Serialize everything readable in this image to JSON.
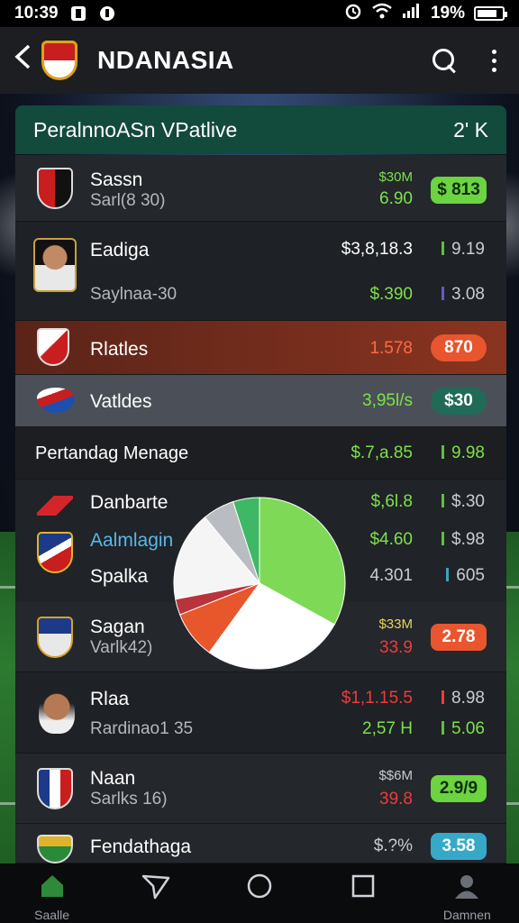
{
  "status_bar": {
    "time": "10:39",
    "battery": "19%"
  },
  "app_bar": {
    "title": "NDANASIA"
  },
  "header": {
    "title": "PeralnnoASn VPatlive",
    "value": "2' K"
  },
  "rows": [
    {
      "name": "Sassn",
      "sub": "Sarl(8 30)",
      "v1": "$30M",
      "v2": "6.90",
      "pill": "$ 813"
    },
    {
      "name": "Eadiga",
      "sub": "Saylnaa-30",
      "v1": "$3,8,18.3",
      "v2": "$.390",
      "r1": "9.19",
      "r2": "3.08"
    },
    {
      "name": "Rlatles",
      "v1": "1.578",
      "pill": "870"
    },
    {
      "name": "Vatldes",
      "v1": "3,95l/s",
      "pill": "$30"
    }
  ],
  "section": {
    "title": "Pertandag Menage",
    "v1": "$.7,a.85",
    "v2": "9.98"
  },
  "section_rows": [
    {
      "name": "Danbarte",
      "v1": "$,6l.8",
      "v2": "$.30"
    },
    {
      "name": "Aalmlagin",
      "v1": "$4.60",
      "v2": "$.98"
    },
    {
      "name": "Spalka",
      "v1": "4.301",
      "v2": "605"
    }
  ],
  "rows2": [
    {
      "name": "Sagan",
      "sub": "Varlk42)",
      "v1": "$33M",
      "v2": "33.9",
      "pill": "2.78"
    },
    {
      "name": "Rlaa",
      "sub": "Rardinao1 35",
      "v1": "$1,1.15.5",
      "v2": "2,57 H",
      "r1": "8.98",
      "r2": "5.06"
    },
    {
      "name": "Naan",
      "sub": "Sarlks 16)",
      "v1": "$$6M",
      "v2": "39.8",
      "pill": "2.9/9"
    },
    {
      "name": "Fendathaga",
      "v1": "$.?%",
      "pill": "3.58"
    }
  ],
  "nav": {
    "home": "Saalle",
    "profile": "Damnen"
  },
  "colors": {
    "accent_green": "#7ee04a",
    "accent_red": "#ef3b3b",
    "header_bg": "#124a3c",
    "orange_row": "#7a2e1e"
  },
  "icons": [
    "back-arrow-icon",
    "search-icon",
    "more-vert-icon",
    "home-icon",
    "send-icon",
    "circle-icon",
    "square-icon",
    "profile-icon"
  ],
  "chart_data": {
    "type": "pie",
    "slices": [
      {
        "color": "#7ed957",
        "value": 33
      },
      {
        "color": "#ffffff",
        "value": 27
      },
      {
        "color": "#e8562c",
        "value": 9
      },
      {
        "color": "#b8343a",
        "value": 3
      },
      {
        "color": "#f5f5f5",
        "value": 17
      },
      {
        "color": "#b9bcc0",
        "value": 6
      },
      {
        "color": "#3fb865",
        "value": 5
      }
    ]
  }
}
